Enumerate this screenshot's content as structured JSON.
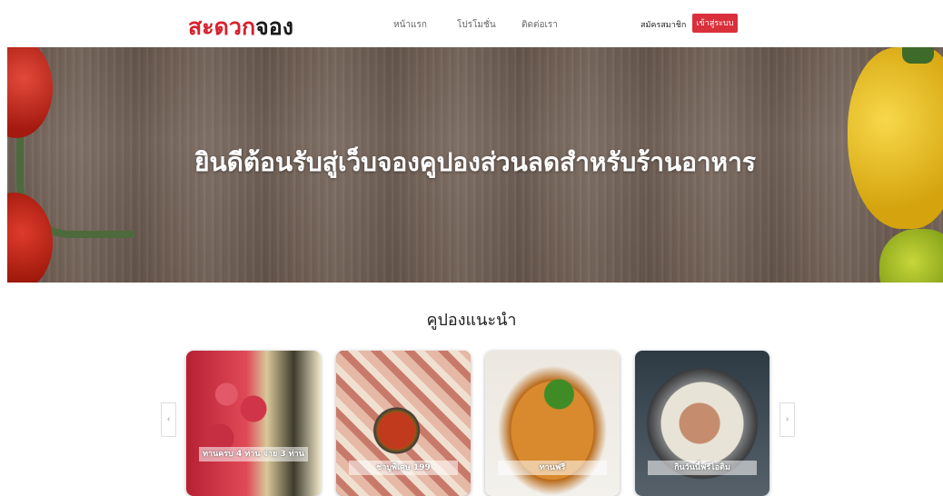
{
  "navbar": {
    "logo_red": "สะดวก",
    "logo_dark": "จอง",
    "links": [
      "หน้าแรก",
      "โปรโมชั่น",
      "ติดต่อเรา"
    ],
    "signup_label": "สมัครสมาชิก",
    "login_label": "เข้าสู่ระบบ"
  },
  "hero": {
    "title": "ยินดีต้อนรับสู่เว็บจองคูปองส่วนลดสำหรับร้านอาหาร"
  },
  "coupons": {
    "section_title": "คูปองแนะนำ",
    "prev_icon": "chevron-left-icon",
    "next_icon": "chevron-right-icon",
    "prev_glyph": "‹",
    "next_glyph": "›",
    "cards": [
      {
        "label": "ทานครบ 4 ท่าน จ่าย 3 ท่าน"
      },
      {
        "label": "ชาบูพิเศษ 199"
      },
      {
        "label": "ทานฟรี"
      },
      {
        "label": "กินวันนี้ฟรีไอติม"
      }
    ]
  },
  "colors": {
    "brand_red": "#d6222e",
    "login_button": "#d9303c"
  }
}
